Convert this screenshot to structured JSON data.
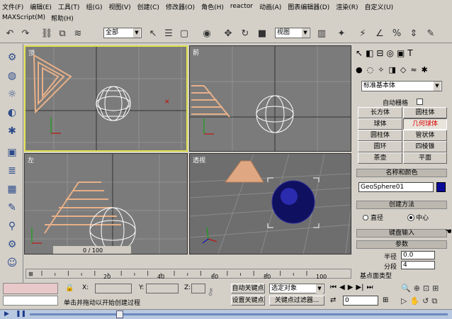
{
  "menu": [
    "文件(F)",
    "编辑(E)",
    "工具(T)",
    "组(G)",
    "视图(V)",
    "创建(C)",
    "修改器(O)",
    "角色(H)",
    "reactor",
    "动画(A)",
    "图表编辑器(D)",
    "渲染(R)",
    "自定义(U)",
    "MAXScript(M)",
    "帮助(H)"
  ],
  "toolbar": {
    "selection_filter": "全部",
    "coord": "视图"
  },
  "viewports": {
    "top": "顶",
    "front": "前",
    "left": "左",
    "persp": "透视"
  },
  "panel": {
    "dropdown": "标准基本体",
    "autogrid": "自动栅格",
    "buttons": [
      "长方体",
      "圆柱体",
      "球体",
      "几何球体",
      "圆柱体",
      "管状体",
      "圆环",
      "四棱锥",
      "茶壶",
      "平面"
    ],
    "name_header": "名称和颜色",
    "object_name": "GeoSphere01",
    "method_header": "创建方法",
    "radio1": "直径",
    "radio2": "中心",
    "keyboard_header": "键盘输入",
    "params_header": "参数",
    "radius_label": "半径",
    "radius_value": "0.0",
    "segments_label": "分段",
    "segments_value": "4",
    "type_label": "基点面类型"
  },
  "timeline": {
    "frame": "0 / 100",
    "ticks": [
      "0",
      "20",
      "40",
      "60",
      "80",
      "100"
    ]
  },
  "status": {
    "x_label": "X:",
    "y_label": "Y:",
    "z_label": "Z:",
    "autokey": "自动关键点",
    "setkey": "设置关键点",
    "selected": "选定对象",
    "keyfilter": "关键点过滤器...",
    "prompt": "单击并拖动以开始创建过程",
    "frame_value": "0"
  }
}
